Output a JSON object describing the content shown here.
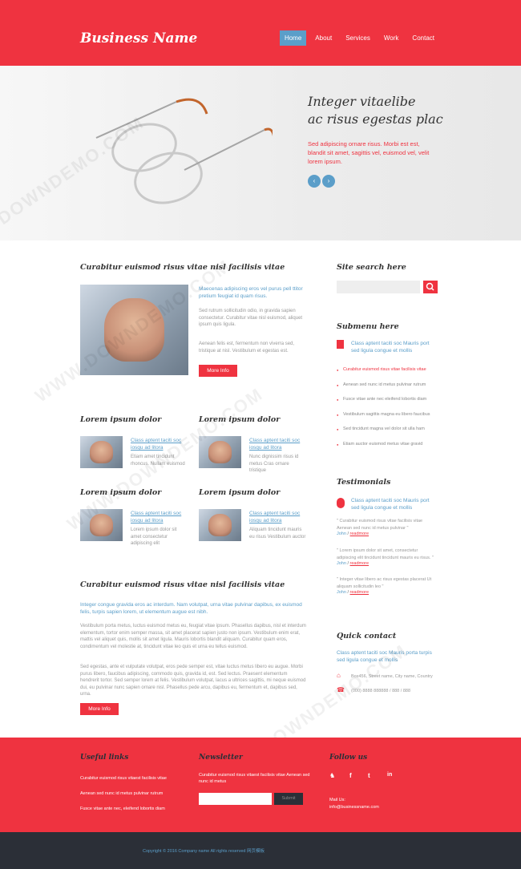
{
  "header": {
    "brand": "Business Name",
    "nav": [
      "Home",
      "About",
      "Services",
      "Work",
      "Contact"
    ]
  },
  "hero": {
    "title_line1": "Integer vitaelibe",
    "title_line2": "ac risus egestas plac",
    "text": "Sed adipiscing ornare risus. Morbi est est, blandit sit amet, sagittis vel, euismod vel, velit lorem ipsum.",
    "prev_symbol": "‹",
    "next_symbol": "›"
  },
  "main": {
    "feature": {
      "title": "Curabitur euismod risus vitae nisl facilisis vitae",
      "lead": "Maecenas adipiscing eros vel purus pell ttitor pretium feugiat id quam risus.",
      "para1": "Sed rutrum sollicitudin odio, in gravida sapien consectetur. Curabitur vitae nisl euismod, aliquet ipsum quis ligula.",
      "para2": "Aenean felis est, fermentum non viverra sed, tristique at nisl. Vestibulum et egestas est.",
      "button": "More Info"
    },
    "items": [
      {
        "title": "Lorem ipsum dolor",
        "link": "Class aptent taciti soc iosqu ad litora",
        "text": "Etiam amet tincidunt rhoncus. Nullam euismod"
      },
      {
        "title": "Lorem ipsum dolor",
        "link": "Class aptent taciti soc iosqu ad litora",
        "text": "Nunc dignissim risus id metus Cras ornare tristique"
      },
      {
        "title": "Lorem ipsum dolor",
        "link": "Class aptent taciti soc iosqu ad litora",
        "text": "Lorem ipsum dolor sit amet consectetur adipiscing elit"
      },
      {
        "title": "Lorem ipsum dolor",
        "link": "Class aptent taciti soc iosqu ad litora",
        "text": "Aliquam tincidunt mauris eu risus Vestibulum auctor"
      }
    ],
    "article": {
      "title": "Curabitur euismod risus vitae nisl facilisis vitae",
      "lead": "Integer congue gravida eros ac interdum. Nam volutpat, urna vitae pulvinar dapibus, ex euismod felis, turpis sapien lorem, ut elementum augue est nibh.",
      "para1": "Vestibulum porta metus, luctus euismod metus eu, feugiat vitae ipsum. Phasellus dapibus, nisl et interdum elementum, tortor enim semper massa, sit amet placerat sapien justo non ipsum. Vestibulum enim erat, mattis vel aliquet quis, mollis sit amet ligula. Mauris lobortis blandit aliquam. Curabitur quam eros, condimentum vel molestie at, tincidunt vitae leo quis et urna eu tellus euismod.",
      "para2": "Sed egestas, ante et vulputate volutpat, eros pede semper est, vitae luctus metus libero eu augue. Morbi purus libero, faucibus adipiscing, commodo quis, gravida id, est. Sed lectus. Praesent elementum hendrerit tortor. Sed semper lorem at felis. Vestibulum volutpat, lacus a ultrices sagittis, mi neque euismod dui, eu pulvinar nunc sapien ornare nisl. Phasellus pede arcu, dapibus eu, fermentum et, dapibus sed, urna.",
      "button": "More Info"
    }
  },
  "sidebar": {
    "search_title": "Site search here",
    "search_placeholder": "",
    "submenu_title": "Submenu here",
    "submenu_intro": "Class aptent taciti soc Mauris port sed ligula congue et mollis",
    "submenu_items": [
      "Curabitur euismod risus vitae facilisis vitae",
      "Aenean sed nunc id metus pulvinar rutrum",
      "Fusce vitae ante nec eleifend lobortis diam",
      "Vestibulum sagittis magna eu libero faucibus",
      "Sed tincidunt magna vel dolor sit ulla ham",
      "Etiam auctor euismod metus vitae gravid"
    ],
    "testimonials_title": "Testimonials",
    "testimonials_intro": "Class aptent taciti soc Mauris port sed ligula congue et mollis",
    "testimonials": [
      {
        "quote": "\" Curabitur euismod risus vitae facilisis vitae Aenean sed nunc id metus pulvinar \"",
        "author": "John",
        "link": "readmore"
      },
      {
        "quote": "\" Lorem ipsum dolor sit amet, consectetur adipiscing elit tincidunt tincidunt mauris eu risus. \"",
        "author": "John",
        "link": "readmore"
      },
      {
        "quote": "\" Integer vitae libero ac risus egestas placerat Ut aliquam sollicitudin leo \"",
        "author": "John",
        "link": "readmore"
      }
    ],
    "contact_title": "Quick contact",
    "contact_intro": "Class aptent taciti soc Mauris porta turpis sed ligula congue et mollis",
    "address": "Box456, Street name, City name, Country",
    "phone": "(000) 8888 888888 / 888 / 888"
  },
  "footer": {
    "links_title": "Useful links",
    "links": [
      "Curabitur euismod risus vitaest facilisis vitae",
      "Aenean sed nunc id metus pulvinar rutrum",
      "Fusce vitae ante nec, eleifend lobortis diam"
    ],
    "newsletter_title": "Newsletter",
    "newsletter_text": "Curabitur euismod risus vitaest facilisis vitae Aenean sed nunc id metus",
    "newsletter_placeholder": "",
    "newsletter_button": "Submit",
    "follow_title": "Follow us",
    "social": [
      "♞",
      "f",
      "t",
      "in"
    ],
    "mail_label": "Mail Us:",
    "mail": "info@businessname.com",
    "copyright": "Copyright © 2016 Company name All rights reserved 网页模板"
  },
  "colors": {
    "accent": "#ef3340",
    "blue": "#5b9ec9",
    "dark": "#2b2f37"
  }
}
